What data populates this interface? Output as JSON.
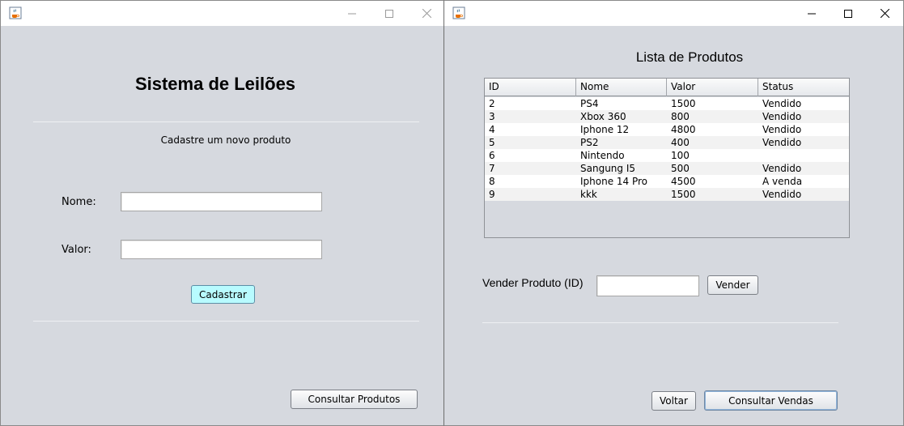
{
  "left_window": {
    "title": "",
    "heading": "Sistema de Leilões",
    "subheading": "Cadastre um novo produto",
    "nome_label": "Nome:",
    "nome_value": "",
    "valor_label": "Valor:",
    "valor_value": "",
    "cadastrar_button": "Cadastrar",
    "consultar_produtos_button": "Consultar Produtos"
  },
  "right_window": {
    "title": "",
    "heading": "Lista de Produtos",
    "table": {
      "columns": [
        "ID",
        "Nome",
        "Valor",
        "Status"
      ],
      "rows": [
        [
          "2",
          "PS4",
          "1500",
          "Vendido"
        ],
        [
          "3",
          "Xbox 360",
          "800",
          "Vendido"
        ],
        [
          "4",
          "Iphone 12",
          "4800",
          "Vendido"
        ],
        [
          "5",
          "PS2",
          "400",
          "Vendido"
        ],
        [
          "6",
          "Nintendo",
          "100",
          ""
        ],
        [
          "7",
          "Sangung I5",
          "500",
          "Vendido"
        ],
        [
          "8",
          "Iphone 14 Pro",
          "4500",
          "A venda"
        ],
        [
          "9",
          "kkk",
          "1500",
          "Vendido"
        ]
      ]
    },
    "vender_label": "Vender Produto (ID)",
    "vender_value": "",
    "vender_button": "Vender",
    "voltar_button": "Voltar",
    "consultar_vendas_button": "Consultar Vendas"
  },
  "icons": {
    "app": "java-coffee-icon",
    "minimize": "minimize-icon",
    "maximize": "maximize-icon",
    "close": "close-icon"
  },
  "colors": {
    "window_bg": "#d6d9df",
    "cadastrar_bg": "#b8fbff"
  }
}
